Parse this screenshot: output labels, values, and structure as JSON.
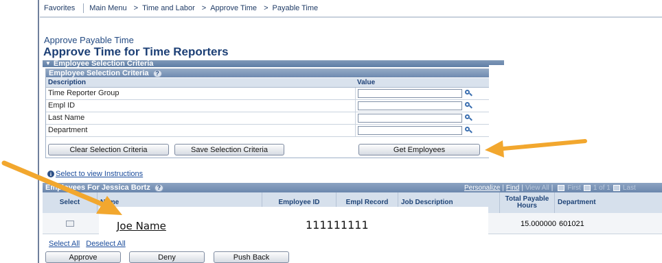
{
  "breadcrumb": {
    "favorites": "Favorites",
    "main_menu": "Main Menu",
    "items": [
      "Time and Labor",
      "Approve Time",
      "Payable Time"
    ],
    "separator": ">"
  },
  "page": {
    "subtitle": "Approve Payable Time",
    "title": "Approve Time for Time Reporters"
  },
  "criteria": {
    "outer_label": "Employee Selection Criteria",
    "inner_label": "Employee Selection Criteria",
    "help": "?",
    "columns": {
      "description": "Description",
      "value": "Value"
    },
    "rows": [
      {
        "label": "Time Reporter Group",
        "value": ""
      },
      {
        "label": "Empl ID",
        "value": ""
      },
      {
        "label": "Last Name",
        "value": ""
      },
      {
        "label": "Department",
        "value": ""
      }
    ],
    "buttons": {
      "clear": "Clear Selection Criteria",
      "save": "Save Selection Criteria",
      "get": "Get Employees"
    }
  },
  "instructions": {
    "icon": "i",
    "link": "Select to view Instructions"
  },
  "grid": {
    "title": "Employees For Jessica Bortz",
    "help": "?",
    "nav": {
      "personalize": "Personalize",
      "find": "Find",
      "view_all": "View All",
      "first": "First",
      "counter": "1 of 1",
      "last": "Last"
    },
    "columns": {
      "select": "Select",
      "name": "Name",
      "employee_id": "Employee ID",
      "empl_record": "Empl Record",
      "job_description": "Job Description",
      "total_hours": "Total Payable Hours",
      "department": "Department"
    },
    "rows": [
      {
        "name": "Joe Name",
        "employee_id": "111111111",
        "total_hours": "15.000000",
        "department": "601021"
      }
    ]
  },
  "selection_links": {
    "select_all": "Select All",
    "deselect_all": "Deselect All"
  },
  "actions": {
    "approve": "Approve",
    "deny": "Deny",
    "push_back": "Push Back"
  },
  "colors": {
    "header_blue": "#6b87ad",
    "title_blue": "#1c3f75",
    "link_blue": "#1a4b9b",
    "arrow_orange": "#f2a72e"
  }
}
